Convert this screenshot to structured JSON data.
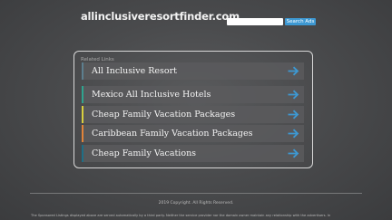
{
  "header": {
    "site_title": "allinclusiveresortfinder.com",
    "search_placeholder": "",
    "search_button_label": "Search Ads"
  },
  "related": {
    "heading": "Related Links",
    "items": [
      {
        "label": "All Inclusive Resort",
        "bar_color": "#5d7f8f",
        "arrow_icon": "arrow-right-icon"
      },
      {
        "label": "Mexico All Inclusive Hotels",
        "bar_color": "#2fa38f",
        "arrow_icon": "arrow-right-icon"
      },
      {
        "label": "Cheap Family Vacation Packages",
        "bar_color": "#d8cf3f",
        "arrow_icon": "arrow-right-icon"
      },
      {
        "label": "Caribbean Family Vacation Packages",
        "bar_color": "#e1843a",
        "arrow_icon": "arrow-right-icon"
      },
      {
        "label": "Cheap Family Vacations",
        "bar_color": "#1f6f86",
        "arrow_icon": "arrow-right-icon"
      }
    ]
  },
  "footer": {
    "copyright": "2019 Copyright. All Rights Reserved.",
    "disclaimer": "The Sponsored Listings displayed above are served automatically by a third party. Neither the service provider nor the domain owner maintain any relationship with the advertisers. In"
  },
  "colors": {
    "accent": "#3d98d2",
    "arrow": "#3d98d2"
  }
}
